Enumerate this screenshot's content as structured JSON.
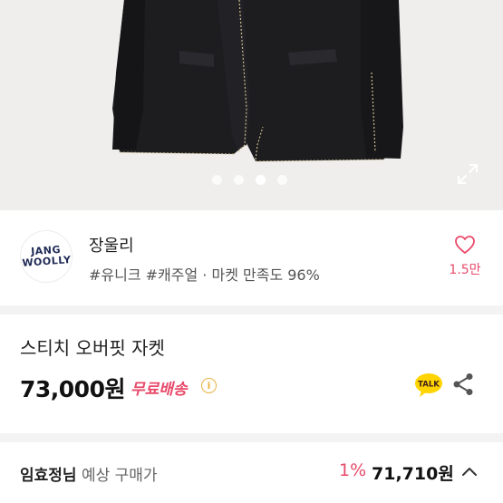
{
  "gallery": {
    "slide_count": 4,
    "active_index": 2
  },
  "seller": {
    "avatar_logo_text": "JANG WOOLLY",
    "name": "장울리",
    "tags": "#유니크 #캐주얼 · 마켓 만족도 96%",
    "likes": "1.5만"
  },
  "product": {
    "title": "스티치 오버핏 자켓",
    "price": "73,000원",
    "shipping": "무료배송",
    "kakao_label": "TALK"
  },
  "expected": {
    "user": "임효정님",
    "label": "예상 구매가",
    "discount": "1%",
    "price": "71,710원"
  },
  "colors": {
    "accent": "#e84a6a",
    "jacket": "#1c1c1e",
    "kakao": "#ffd400"
  },
  "icons": [
    "expand-icon",
    "heart-icon",
    "info-icon",
    "kakao-talk-icon",
    "share-icon",
    "chevron-up-icon"
  ]
}
